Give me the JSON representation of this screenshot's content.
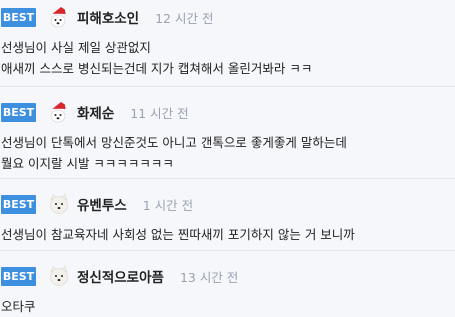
{
  "comments": [
    {
      "badge": "BEST",
      "author": "피해호소인",
      "time": "12 시간 전",
      "lines": [
        "선생님이 사실 제일 상관없지",
        "애새끼 스스로 병신되는건데 지가 캡쳐해서 올린거봐라 ㅋㅋ"
      ],
      "avatar_icon": "santa-dog-icon"
    },
    {
      "badge": "BEST",
      "author": "화제순",
      "time": "11 시간 전",
      "lines": [
        "선생님이 단톡에서 망신준것도 아니고 갠톡으로 좋게좋게 말하는데",
        "뭘요 이지랄 시발 ㅋㅋㅋㅋㅋㅋㅋ"
      ],
      "avatar_icon": "santa-dog-icon"
    },
    {
      "badge": "BEST",
      "author": "유벤투스",
      "time": "1 시간 전",
      "lines": [
        "선생님이 참교육자네 사회성 없는 찐따새끼 포기하지 않는 거 보니까"
      ],
      "avatar_icon": "white-dog-icon"
    },
    {
      "badge": "BEST",
      "author": "정신적으로아픔",
      "time": "13 시간 전",
      "lines": [
        "오타쿠"
      ],
      "avatar_icon": "white-dog-icon"
    }
  ],
  "colors": {
    "badge_bg": "#3d8fe0",
    "time_text": "#9aa3b0",
    "background": "#f5f7fb"
  }
}
